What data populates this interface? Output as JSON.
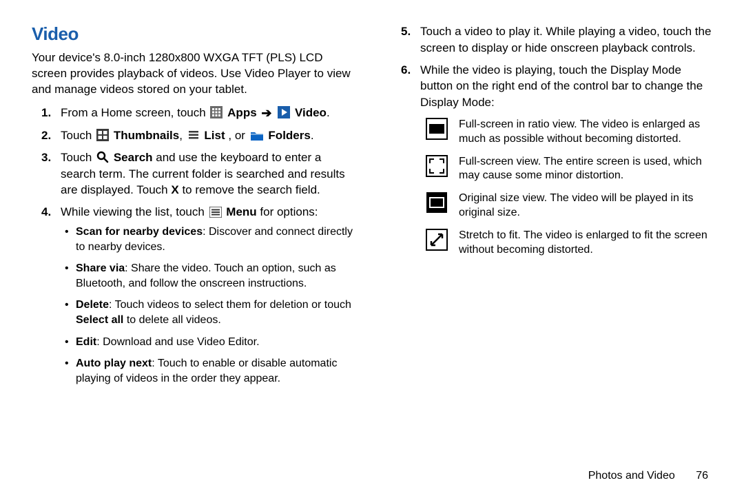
{
  "heading": "Video",
  "intro": "Your device's 8.0-inch 1280x800 WXGA TFT (PLS) LCD screen provides playback of videos. Use Video Player to view and manage videos stored on your tablet.",
  "steps": {
    "s1_a": "From a Home screen, touch ",
    "s1_apps": "Apps",
    "s1_video": "Video",
    "s2_a": "Touch ",
    "s2_thumb": "Thumbnails",
    "s2_list": "List",
    "s2_or": ", or ",
    "s2_folders": "Folders",
    "s3_a": "Touch ",
    "s3_search": "Search",
    "s3_b": " and use the keyboard to enter a search term. The current folder is searched and results are displayed. Touch ",
    "s3_x": "X",
    "s3_c": " to remove the search field.",
    "s4_a": "While viewing the list, touch ",
    "s4_menu": "Menu",
    "s4_b": " for options:",
    "bullets": {
      "b1_h": "Scan for nearby devices",
      "b1_t": ": Discover and connect directly to nearby devices.",
      "b2_h": "Share via",
      "b2_t": ": Share the video. Touch an option, such as Bluetooth, and follow the onscreen instructions.",
      "b3_h": "Delete",
      "b3_t1": ": Touch videos to select them for deletion or touch ",
      "b3_sel": "Select all",
      "b3_t2": " to delete all videos.",
      "b4_h": "Edit",
      "b4_t": ": Download and use Video Editor.",
      "b5_h": "Auto play next",
      "b5_t": ": Touch to enable or disable automatic playing of videos in the order they appear."
    },
    "s5": "Touch a video to play it. While playing a video, touch the screen to display or hide onscreen playback controls.",
    "s6": "While the video is playing, touch the Display Mode button on the right end of the control bar to change the Display Mode:",
    "modes": {
      "m1": "Full-screen in ratio view. The video is enlarged as much as possible without becoming distorted.",
      "m2": "Full-screen view. The entire screen is used, which may cause some minor distortion.",
      "m3": "Original size view. The video will be played in its original size.",
      "m4": "Stretch to fit. The video is enlarged to fit the screen without becoming distorted."
    }
  },
  "footer": {
    "label": "Photos and Video",
    "page": "76"
  }
}
